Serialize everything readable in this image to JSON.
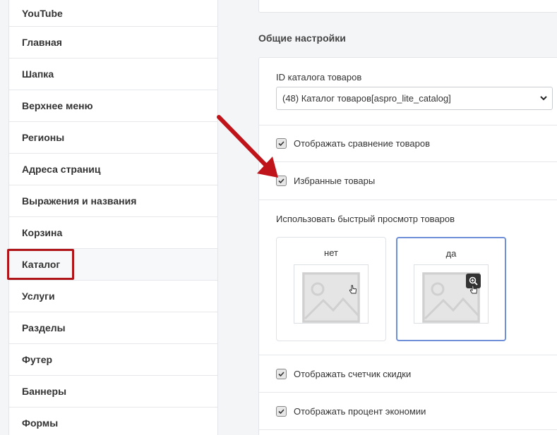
{
  "sidebar": {
    "items": [
      {
        "label": "YouTube"
      },
      {
        "label": "Главная"
      },
      {
        "label": "Шапка"
      },
      {
        "label": "Верхнее меню"
      },
      {
        "label": "Регионы"
      },
      {
        "label": "Адреса страниц"
      },
      {
        "label": "Выражения и названия"
      },
      {
        "label": "Корзина"
      },
      {
        "label": "Каталог"
      },
      {
        "label": "Услуги"
      },
      {
        "label": "Разделы"
      },
      {
        "label": "Футер"
      },
      {
        "label": "Баннеры"
      },
      {
        "label": "Формы"
      }
    ],
    "active_index": 8
  },
  "main": {
    "section_title": "Общие настройки",
    "catalog_id": {
      "label": "ID каталога товаров",
      "selected": "(48) Каталог товаров[aspro_lite_catalog]"
    },
    "checkboxes": {
      "compare": {
        "label": "Отображать сравнение товаров",
        "checked": true
      },
      "favorites": {
        "label": "Избранные товары",
        "checked": true
      },
      "discount_counter": {
        "label": "Отображать счетчик скидки",
        "checked": true
      },
      "savings_percent": {
        "label": "Отображать процент экономии",
        "checked": true
      }
    },
    "quick_view": {
      "label": "Использовать быстрый просмотр товаров",
      "options": [
        {
          "label": "нет",
          "selected": false
        },
        {
          "label": "да",
          "selected": true
        }
      ]
    }
  },
  "colors": {
    "highlight": "#b0151a",
    "selected_border": "#6f8fd8",
    "arrow": "#c0141b"
  },
  "icons": [
    "chevron-down-icon",
    "checkmark-icon",
    "image-placeholder-icon",
    "zoom-in-icon",
    "hand-cursor-icon",
    "arrow-annotation"
  ]
}
